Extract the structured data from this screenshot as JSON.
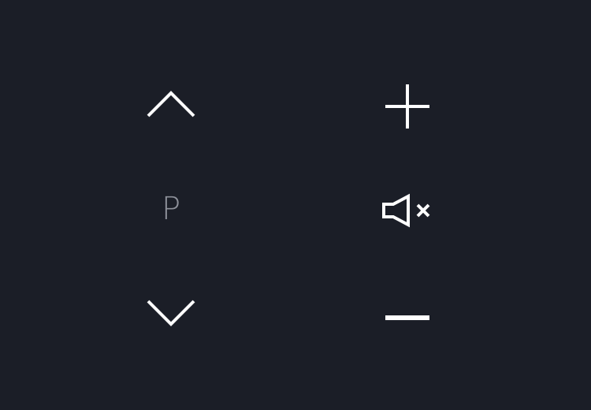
{
  "channel": {
    "label": "P",
    "up_icon": "chevron-up-icon",
    "down_icon": "chevron-down-icon"
  },
  "volume": {
    "up_icon": "plus-icon",
    "mute_icon": "speaker-mute-icon",
    "down_icon": "minus-icon"
  },
  "colors": {
    "background": "#1b1e27",
    "icon": "#ffffff",
    "label": "#8e919a"
  }
}
